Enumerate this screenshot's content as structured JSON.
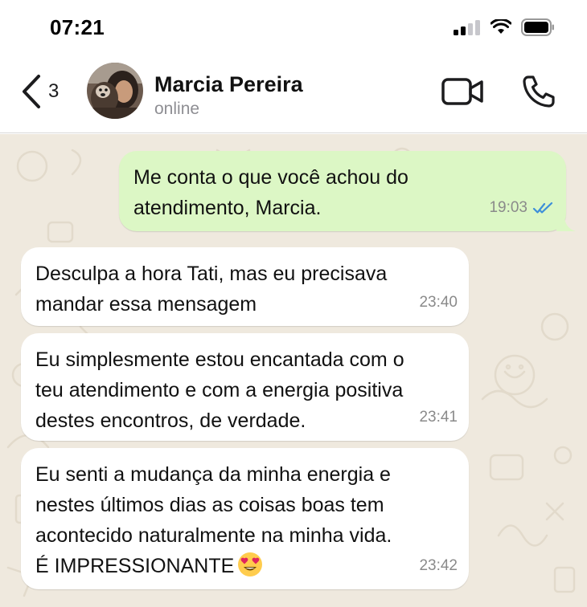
{
  "status_bar": {
    "time": "07:21",
    "icons": [
      "signal-icon",
      "wifi-icon",
      "battery-icon"
    ]
  },
  "header": {
    "back_count": "3",
    "contact_name": "Marcia Pereira",
    "contact_status": "online",
    "icons": [
      "chevron-left-icon",
      "video-call-icon",
      "phone-icon"
    ]
  },
  "colors": {
    "outgoing_bubble": "#dcf7c5",
    "incoming_bubble": "#ffffff",
    "chat_background": "#efe9de",
    "read_ticks": "#3d8fd9"
  },
  "messages": [
    {
      "direction": "outgoing",
      "text": "Me conta o que você achou do\natendimento, Marcia.",
      "time": "19:03",
      "status": "read"
    },
    {
      "direction": "incoming",
      "text": "Desculpa a hora Tati, mas eu precisava\nmandar essa mensagem",
      "time": "23:40"
    },
    {
      "direction": "incoming",
      "text": "Eu simplesmente estou encantada com o\nteu atendimento e com a energia positiva\ndestes encontros, de verdade.",
      "time": "23:41"
    },
    {
      "direction": "incoming",
      "text": "Eu senti a mudança da minha energia e\nnestes últimos dias as coisas boas tem\nacontecido naturalmente na minha vida.\nÉ IMPRESSIONANTE",
      "time": "23:42",
      "emoji": "heart-eyes-emoji"
    }
  ]
}
